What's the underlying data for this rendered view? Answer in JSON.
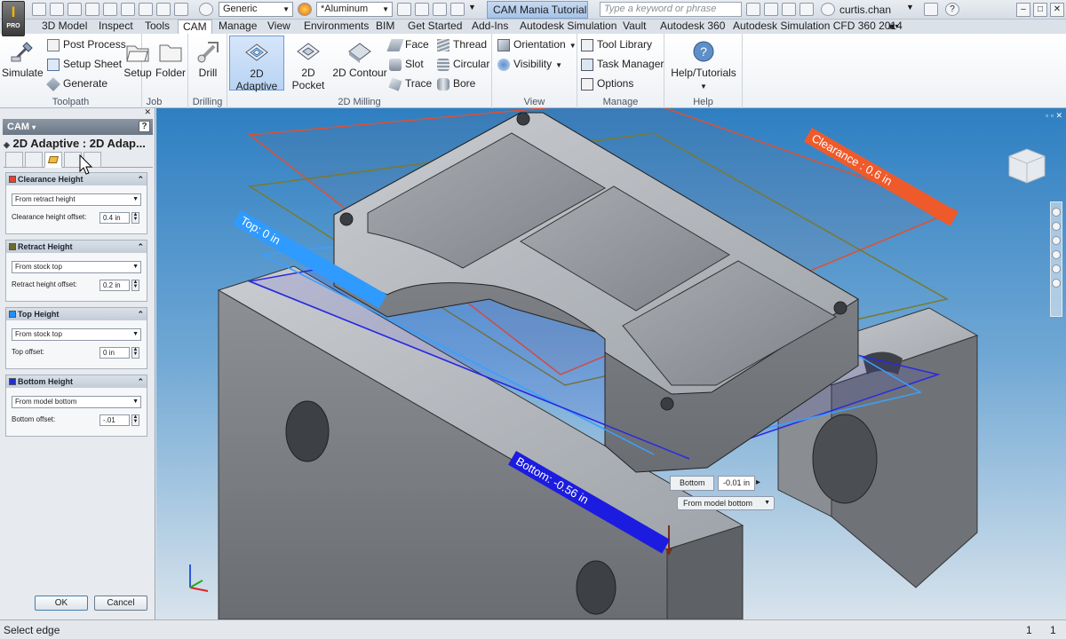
{
  "titlebar": {
    "logo": "I",
    "logo_sub": "PRO",
    "material_combo": "Generic",
    "appearance_combo": "*Aluminum",
    "doc_tab": "CAM Mania Tutorial ...",
    "search_placeholder": "Type a keyword or phrase",
    "user": "curtis.chan"
  },
  "tabs": [
    "3D Model",
    "Inspect",
    "Tools",
    "CAM",
    "Manage",
    "View",
    "Environments",
    "BIM",
    "Get Started",
    "Add-Ins",
    "Autodesk Simulation",
    "Vault",
    "Autodesk 360",
    "Autodesk Simulation CFD 360 2014"
  ],
  "active_tab": "CAM",
  "ribbon": {
    "toolpath": {
      "label": "Toolpath",
      "simulate": "Simulate",
      "post_process": "Post Process",
      "setup_sheet": "Setup Sheet",
      "generate": "Generate"
    },
    "job": {
      "label": "Job",
      "setup": "Setup",
      "folder": "Folder"
    },
    "drilling": {
      "label": "Drilling",
      "drill": "Drill"
    },
    "milling2d": {
      "label": "2D Milling",
      "adaptive": "2D Adaptive",
      "pocket": "2D Pocket",
      "contour": "2D Contour",
      "face": "Face",
      "slot": "Slot",
      "trace": "Trace",
      "thread": "Thread",
      "circular": "Circular",
      "bore": "Bore"
    },
    "view": {
      "label": "View",
      "orientation": "Orientation",
      "visibility": "Visibility"
    },
    "manage": {
      "label": "Manage",
      "tool_library": "Tool Library",
      "task_manager": "Task Manager",
      "options": "Options"
    },
    "help": {
      "label": "Help",
      "help_tutorials": "Help/Tutorials"
    }
  },
  "browser": {
    "panel_title": "CAM",
    "help_glyph": "?",
    "operation_title": "2D Adaptive : 2D Adap...",
    "groups": [
      {
        "title": "Clearance Height",
        "color": "#e8412c",
        "select": "From retract height",
        "field_label": "Clearance height offset:",
        "value": "0.4 in"
      },
      {
        "title": "Retract Height",
        "color": "#6e6a2a",
        "select": "From stock top",
        "field_label": "Retract height offset:",
        "value": "0.2 in"
      },
      {
        "title": "Top Height",
        "color": "#1e90ff",
        "select": "From stock top",
        "field_label": "Top offset:",
        "value": "0 in"
      },
      {
        "title": "Bottom Height",
        "color": "#1c2fd6",
        "select": "From model bottom",
        "field_label": "Bottom offset:",
        "value": "-.01"
      }
    ],
    "ok": "OK",
    "cancel": "Cancel"
  },
  "viewport": {
    "clearance_tag": "Clearance : 0.6 in",
    "top_tag": "Top: 0 in",
    "bottom_tag": "Bottom: -0.56 in",
    "mini_label": "Bottom",
    "mini_value": "-0.01 in",
    "mini_select": "From model bottom"
  },
  "status": {
    "text": "Select edge",
    "n1": "1",
    "n2": "1"
  }
}
